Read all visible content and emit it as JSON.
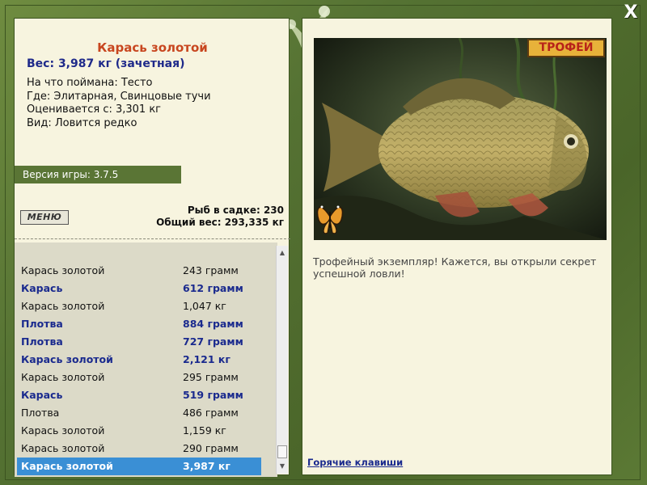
{
  "window": {
    "close_label": "X"
  },
  "fish": {
    "name": "Карась золотой",
    "weight_line": "Вес: 3,987 кг (зачетная)",
    "bait_line": "На что поймана: Тесто",
    "place_line": "Где: Элитарная, Свинцовые тучи",
    "value_line": "Оценивается с: 3,301 кг",
    "kind_line": "Вид: Ловится редко"
  },
  "version": "Версия игры: 3.7.5",
  "menu_label": "МЕНЮ",
  "stats": {
    "fish_count": "Рыб в садке: 230",
    "total_weight": "Общий вес: 293,335 кг"
  },
  "catch_list": [
    {
      "name": "Карась золотой",
      "weight": "243 грамм",
      "style": "normal"
    },
    {
      "name": "Карась",
      "weight": "612 грамм",
      "style": "bold"
    },
    {
      "name": "Карась золотой",
      "weight": "1,047 кг",
      "style": "normal"
    },
    {
      "name": "Плотва",
      "weight": "884 грамм",
      "style": "bold"
    },
    {
      "name": "Плотва",
      "weight": "727 грамм",
      "style": "bold"
    },
    {
      "name": "Карась золотой",
      "weight": "2,121 кг",
      "style": "bold"
    },
    {
      "name": "Карась золотой",
      "weight": "295 грамм",
      "style": "normal"
    },
    {
      "name": "Карась",
      "weight": "519 грамм",
      "style": "bold"
    },
    {
      "name": "Плотва",
      "weight": "486 грамм",
      "style": "normal"
    },
    {
      "name": "Карась золотой",
      "weight": "1,159 кг",
      "style": "normal"
    },
    {
      "name": "Карась золотой",
      "weight": "290 грамм",
      "style": "normal"
    },
    {
      "name": "Карась золотой",
      "weight": "3,987 кг",
      "style": "selected"
    }
  ],
  "trophy_label": "ТРОФЕЙ",
  "caption": "Трофейный экземпляр! Кажется, вы открыли секрет успешной ловли!",
  "hotkeys_label": "Горячие клавиши",
  "icons": {
    "close": "close-icon",
    "decoration": "plant-ornament-icon",
    "butterfly": "butterfly-icon",
    "scroll_up": "scroll-up-icon",
    "scroll_down": "scroll-down-icon"
  },
  "colors": {
    "frame": "#557233",
    "panel": "#f7f4df",
    "fish_name": "#c8461f",
    "bold_item": "#1a2a8e",
    "selected": "#3a8fd5"
  }
}
